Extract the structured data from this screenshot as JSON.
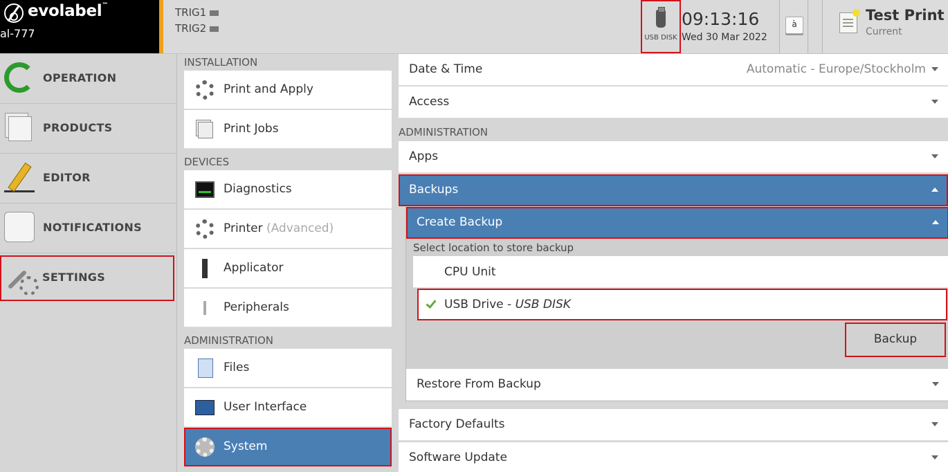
{
  "header": {
    "brand": "evolabel",
    "trademark": "™",
    "model": "al-777",
    "triggers": [
      "TRIG1",
      "TRIG2"
    ],
    "usb_label": "USB DISK",
    "time": "09:13:16",
    "date": "Wed 30 Mar 2022",
    "keyboard_key": "à",
    "test_print_title": "Test Print",
    "test_print_sub": "Current"
  },
  "nav": {
    "items": [
      {
        "label": "OPERATION",
        "icon": "refresh-icon"
      },
      {
        "label": "PRODUCTS",
        "icon": "documents-icon"
      },
      {
        "label": "EDITOR",
        "icon": "pencil-icon"
      },
      {
        "label": "NOTIFICATIONS",
        "icon": "speech-bubble-icon"
      },
      {
        "label": "SETTINGS",
        "icon": "wrench-gear-icon"
      }
    ]
  },
  "middle": {
    "sections": {
      "installation": "INSTALLATION",
      "devices": "DEVICES",
      "administration": "ADMINISTRATION"
    },
    "items": {
      "print_apply": "Print and Apply",
      "print_jobs": "Print Jobs",
      "diagnostics": "Diagnostics",
      "printer": "Printer",
      "printer_sub": "(Advanced)",
      "applicator": "Applicator",
      "peripherals": "Peripherals",
      "files": "Files",
      "user_interface": "User Interface",
      "system": "System"
    }
  },
  "right": {
    "date_time": "Date & Time",
    "date_time_value": "Automatic - Europe/Stockholm",
    "access": "Access",
    "admin_section": "ADMINISTRATION",
    "apps": "Apps",
    "backups": "Backups",
    "create_backup": "Create Backup",
    "select_location": "Select location to store backup",
    "loc_cpu": "CPU Unit",
    "loc_usb": "USB Drive - ",
    "loc_usb_name": "USB DISK",
    "backup_button": "Backup",
    "restore": "Restore From Backup",
    "factory": "Factory Defaults",
    "software_update": "Software Update"
  },
  "colors": {
    "accent_blue": "#4a7fb4",
    "highlight_red": "#d0121b",
    "header_orange": "#f0a01e"
  }
}
